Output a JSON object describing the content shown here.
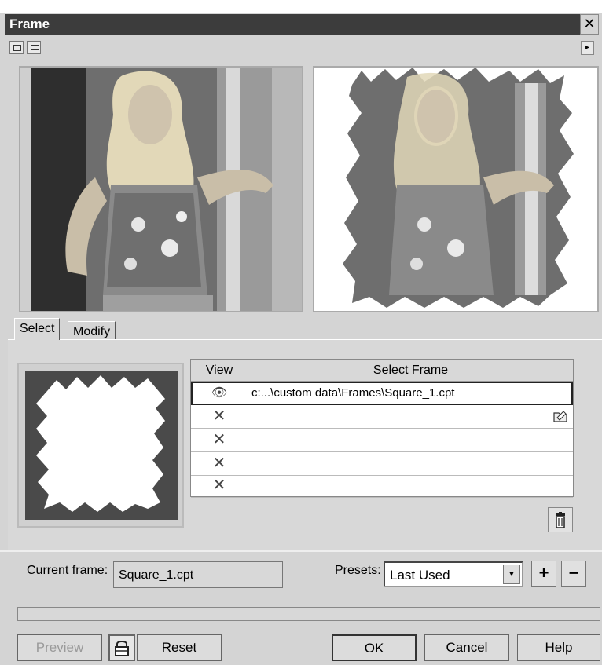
{
  "window": {
    "title": "Frame",
    "close_glyph": "✕"
  },
  "toolbar": {
    "left_icons": [
      "preview-window-icon",
      "single-view-icon"
    ],
    "menu_arrow": "▸"
  },
  "tabs": [
    {
      "label": "Select",
      "active": true
    },
    {
      "label": "Modify",
      "active": false
    }
  ],
  "frame_table": {
    "headers": {
      "view": "View",
      "frame": "Select Frame"
    },
    "rows": [
      {
        "view": "👁",
        "path": "c:...\\custom data\\Frames\\Square_1.cpt",
        "selected": true
      },
      {
        "view": "✕",
        "path": ""
      },
      {
        "view": "✕",
        "path": ""
      },
      {
        "view": "✕",
        "path": ""
      },
      {
        "view": "✕",
        "path": ""
      }
    ]
  },
  "current_frame": {
    "label": "Current frame:",
    "value": "Square_1.cpt"
  },
  "presets": {
    "label": "Presets:",
    "value": "Last Used",
    "add": "+",
    "remove": "−"
  },
  "buttons": {
    "preview": "Preview",
    "reset": "Reset",
    "ok": "OK",
    "cancel": "Cancel",
    "help": "Help"
  },
  "colors": {
    "titlebar": "#3c3c3c",
    "dialog": "#d4d4d4",
    "frame_bg": "#4a4a4a"
  }
}
